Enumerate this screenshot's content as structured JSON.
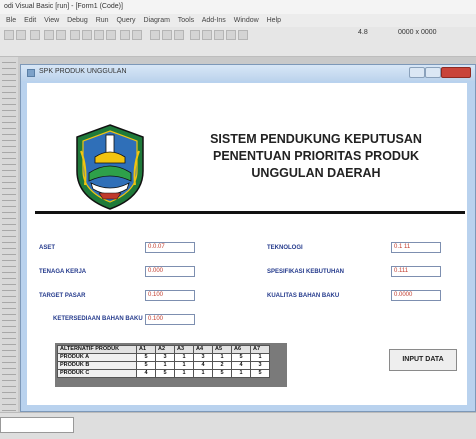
{
  "ide": {
    "title": "odi Visual Basic [run] - [Form1 (Code)]",
    "menu": [
      "Ble",
      "Edit",
      "View",
      "Debug",
      "Run",
      "Query",
      "Diagram",
      "Tools",
      "Add-Ins",
      "Window",
      "Help"
    ],
    "toolbar_size": "4.8",
    "toolbar_coords": "0000 x 0000"
  },
  "window": {
    "title": "SPK PRODUK UNGGULAN"
  },
  "app": {
    "title_lines": [
      "SISTEM PENDUKUNG KEPUTUSAN",
      "PENENTUAN PRIORITAS PRODUK",
      "UNGGULAN DAERAH"
    ]
  },
  "fields": {
    "aset": {
      "label": "ASET",
      "value": "0.0.07"
    },
    "tenaga_kerja": {
      "label": "TENAGA KERJA",
      "value": "0.000"
    },
    "target_pasar": {
      "label": "TARGET PASAR",
      "value": "0.100"
    },
    "ketersediaan_bahan_baku": {
      "label": "KETERSEDIAAN BAHAN BAKU",
      "value": "0.100"
    },
    "teknologi": {
      "label": "TEKNOLOGI",
      "value": "0.1 11"
    },
    "spesifikasi_kebutuhan": {
      "label": "SPESIFIKASI KEBUTUHAN",
      "value": "0.111"
    },
    "kualitas_bahan_baku": {
      "label": "KUALITAS BAHAN BAKU",
      "value": "0.0000"
    }
  },
  "grid": {
    "headers": [
      "ALTERNATIF PRODUK",
      "A1",
      "A2",
      "A3",
      "A4",
      "A5",
      "A6",
      "A7"
    ],
    "rows": [
      {
        "name": "PRODUK A",
        "values": [
          "5",
          "3",
          "1",
          "3",
          "1",
          "5",
          "1"
        ]
      },
      {
        "name": "PRODUK B",
        "values": [
          "5",
          "1",
          "1",
          "4",
          "2",
          "4",
          "3"
        ]
      },
      {
        "name": "PRODUK C",
        "values": [
          "4",
          "5",
          "1",
          "1",
          "5",
          "1",
          "5"
        ]
      }
    ]
  },
  "buttons": {
    "input_data": "INPUT DATA"
  },
  "colors": {
    "label": "#243a8c",
    "value": "#c0392b",
    "window_frame": "#b9d2ee",
    "close": "#c9443a"
  }
}
